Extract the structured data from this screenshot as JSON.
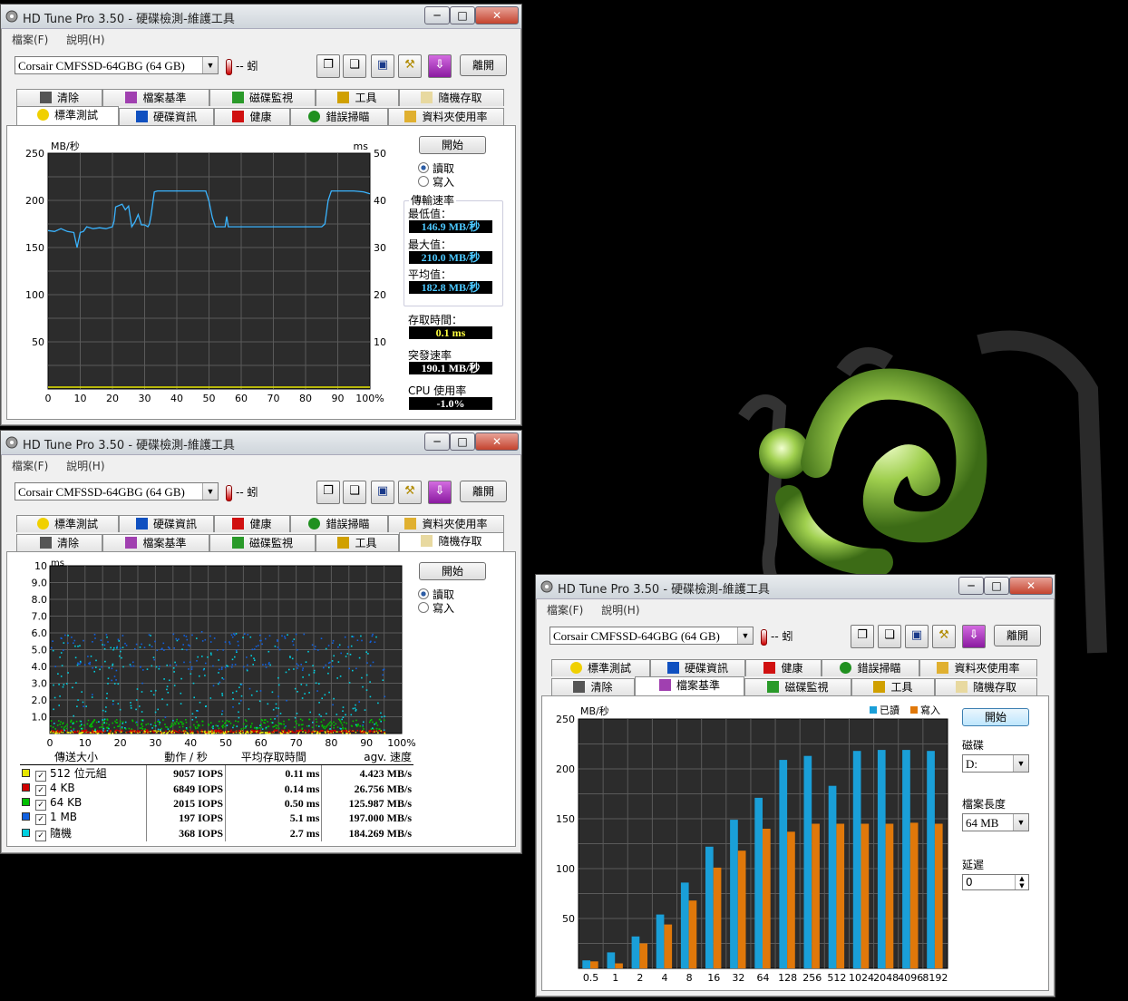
{
  "app_title": "HD Tune Pro 3.50 - 硬碟檢測-維護工具",
  "menu": {
    "file": "檔案(F)",
    "help": "說明(H)"
  },
  "drive": "Corsair CMFSSD-64GBG (64 GB)",
  "temperature": "-- 蚓",
  "exit_label": "離開",
  "start_label": "開始",
  "radio": {
    "read": "讀取",
    "write": "寫入"
  },
  "tabs": {
    "benchmark": "標準測試",
    "info": "硬碟資訊",
    "health": "健康",
    "error_scan": "錯誤掃瞄",
    "folder_usage": "資料夾使用率",
    "erase": "清除",
    "file_benchmark": "檔案基準",
    "disk_monitor": "磁碟監視",
    "tools": "工具",
    "random_access": "隨機存取"
  },
  "benchmark": {
    "y_unit_left": "MB/秒",
    "y_unit_right": "ms",
    "transfer_label": "傳輸速率",
    "min_label": "最低值：",
    "min_value": "146.9 MB/秒",
    "max_label": "最大值：",
    "max_value": "210.0 MB/秒",
    "avg_label": "平均值：",
    "avg_value": "182.8 MB/秒",
    "access_label": "存取時間：",
    "access_value": "0.1 ms",
    "burst_label": "突發速率",
    "burst_value": "190.1 MB/秒",
    "cpu_label": "CPU 使用率",
    "cpu_value": "-1.0%"
  },
  "random": {
    "y_unit": "ms",
    "headers": [
      "傳送大小",
      "動作 / 秒",
      "平均存取時間",
      "agv. 速度"
    ],
    "rows": [
      {
        "color": "#e6e600",
        "size": "512 位元組",
        "iops": "9057 IOPS",
        "access": "0.11 ms",
        "speed": "4.423 MB/s"
      },
      {
        "color": "#d00000",
        "size": "4 KB",
        "iops": "6849 IOPS",
        "access": "0.14 ms",
        "speed": "26.756 MB/s"
      },
      {
        "color": "#00c000",
        "size": "64 KB",
        "iops": "2015 IOPS",
        "access": "0.50 ms",
        "speed": "125.987 MB/s"
      },
      {
        "color": "#1060e0",
        "size": "1 MB",
        "iops": "197 IOPS",
        "access": "5.1 ms",
        "speed": "197.000 MB/s"
      },
      {
        "color": "#00d0e0",
        "size": "隨機",
        "iops": "368 IOPS",
        "access": "2.7 ms",
        "speed": "184.269 MB/s"
      }
    ]
  },
  "file_bench": {
    "y_unit": "MB/秒",
    "legend_read": "已讀",
    "legend_write": "寫入",
    "disk_label": "磁碟",
    "disk_value": "D:",
    "file_length_label": "檔案長度",
    "file_length_value": "64 MB",
    "delay_label": "延遲",
    "delay_value": "0"
  },
  "chart_data": [
    {
      "type": "line",
      "title": "",
      "xlabel": "",
      "ylabel": "MB/秒",
      "y2label": "ms",
      "xlim": [
        0,
        100
      ],
      "ylim": [
        0,
        250
      ],
      "y2lim": [
        0,
        50
      ],
      "x_ticks": [
        "0",
        "10",
        "20",
        "30",
        "40",
        "50",
        "60",
        "70",
        "80",
        "90",
        "100%"
      ],
      "y_ticks": [
        50,
        100,
        150,
        200,
        250
      ],
      "y2_ticks": [
        10,
        20,
        30,
        40,
        50
      ],
      "grid": true,
      "series": [
        {
          "x": [
            0,
            2,
            4,
            6,
            8,
            9,
            10,
            11,
            12,
            14,
            16,
            18,
            20,
            20.5,
            21,
            23,
            24,
            25,
            26,
            27,
            28,
            29,
            30,
            31,
            31.5,
            32,
            33,
            34,
            35,
            40,
            45,
            49,
            50,
            51,
            52,
            54,
            55,
            55.5,
            56,
            58,
            60,
            65,
            70,
            75,
            80,
            85,
            86,
            87,
            88,
            89,
            90,
            92,
            95,
            98,
            100
          ],
          "y": [
            168,
            167,
            170,
            167,
            166,
            150,
            166,
            167,
            172,
            170,
            171,
            170,
            172,
            178,
            193,
            196,
            190,
            194,
            172,
            177,
            185,
            174,
            174,
            172,
            175,
            184,
            209,
            210,
            210,
            210,
            210,
            210,
            199,
            182,
            172,
            172,
            172,
            183,
            172,
            172,
            172,
            172,
            172,
            172,
            172,
            172,
            175,
            200,
            210,
            210,
            210,
            210,
            210,
            209,
            207
          ]
        }
      ]
    },
    {
      "type": "scatter",
      "title": "",
      "ylabel": "ms",
      "xlim": [
        0,
        100
      ],
      "ylim": [
        0,
        10
      ],
      "x_ticks": [
        "0",
        "10",
        "20",
        "30",
        "40",
        "50",
        "60",
        "70",
        "80",
        "90",
        "100%"
      ],
      "y_ticks": [
        "1.0",
        "2.0",
        "3.0",
        "4.0",
        "5.0",
        "6.0",
        "7.0",
        "8.0",
        "9.0",
        "10"
      ],
      "grid": true,
      "series": [
        {
          "name": "512 位元組",
          "y_range": [
            0.05,
            0.2
          ]
        },
        {
          "name": "4 KB",
          "y_range": [
            0.1,
            0.25
          ]
        },
        {
          "name": "64 KB",
          "y_range": [
            0.3,
            0.9
          ]
        },
        {
          "name": "1 MB",
          "y_range": [
            0.2,
            6.2
          ]
        },
        {
          "name": "隨機",
          "y_range": [
            0.2,
            6.0
          ]
        }
      ]
    },
    {
      "type": "bar",
      "title": "",
      "ylabel": "MB/秒",
      "ylim": [
        0,
        250
      ],
      "y_ticks": [
        50,
        100,
        150,
        200,
        250
      ],
      "grid": true,
      "legend": "top-right",
      "categories": [
        "0.5",
        "1",
        "2",
        "4",
        "8",
        "16",
        "32",
        "64",
        "128",
        "256",
        "512",
        "1024",
        "2048",
        "4096",
        "8192"
      ],
      "series": [
        {
          "name": "已讀",
          "color": "#1a9fd8",
          "values": [
            8,
            16,
            32,
            54,
            86,
            122,
            149,
            171,
            209,
            213,
            183,
            218,
            219,
            219,
            218
          ]
        },
        {
          "name": "寫入",
          "color": "#e0780a",
          "values": [
            7,
            5,
            25,
            44,
            68,
            101,
            118,
            140,
            137,
            145,
            145,
            145,
            145,
            146,
            145
          ]
        }
      ]
    }
  ]
}
